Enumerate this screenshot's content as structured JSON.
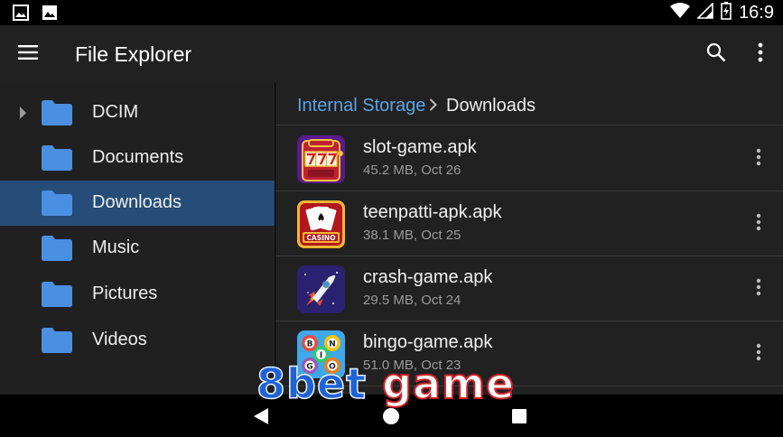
{
  "status_bar": {
    "time": "16:9",
    "left_icons": [
      "image-icon",
      "photo-icon"
    ],
    "right_icons": [
      "wifi-icon",
      "signal-icon",
      "battery-icon"
    ]
  },
  "app_bar": {
    "title": "File Explorer",
    "icons": [
      "menu-icon",
      "search-icon",
      "more-vert-icon"
    ]
  },
  "sidebar": {
    "items": [
      {
        "label": "DCIM",
        "expandable": true,
        "selected": false
      },
      {
        "label": "Documents",
        "expandable": false,
        "selected": false
      },
      {
        "label": "Downloads",
        "expandable": false,
        "selected": true
      },
      {
        "label": "Music",
        "expandable": false,
        "selected": false
      },
      {
        "label": "Pictures",
        "expandable": false,
        "selected": false
      },
      {
        "label": "Videos",
        "expandable": false,
        "selected": false
      }
    ]
  },
  "breadcrumb": {
    "root": "Internal Storage",
    "current": "Downloads"
  },
  "files": [
    {
      "name": "slot-game.apk",
      "meta": "45.2 MB, Oct 26",
      "icon": "slot-machine-icon"
    },
    {
      "name": "teenpatti-apk.apk",
      "meta": "38.1 MB, Oct 25",
      "icon": "casino-cards-icon"
    },
    {
      "name": "crash-game.apk",
      "meta": "29.5 MB, Oct 24",
      "icon": "rocket-icon"
    },
    {
      "name": "bingo-game.apk",
      "meta": "51.0 MB, Oct 23",
      "icon": "bingo-balls-icon"
    }
  ],
  "watermark": {
    "part1": "8bet",
    "part2": "game"
  },
  "colors": {
    "accent": "#5aa4e6",
    "selected_bg": "#254d78",
    "folder": "#4a90e2",
    "app_bar": "#212121"
  }
}
